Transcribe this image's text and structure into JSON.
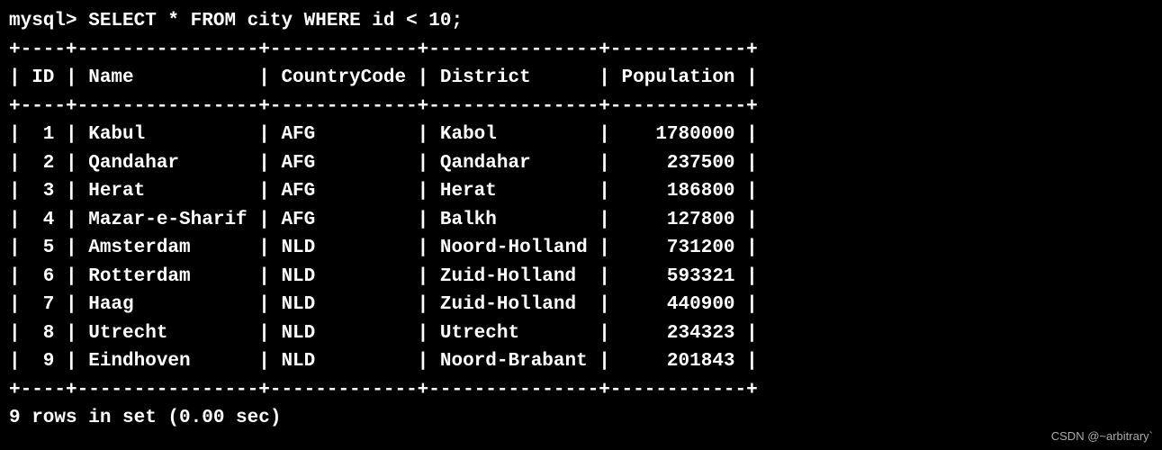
{
  "prompt": "mysql> ",
  "query": "SELECT * FROM city WHERE id < 10;",
  "separator_top": "+----+----------------+-------------+---------------+------------+",
  "header_line": "| ID | Name           | CountryCode | District      | Population |",
  "separator_mid": "+----+----------------+-------------+---------------+------------+",
  "row_lines": [
    "|  1 | Kabul          | AFG         | Kabol         |    1780000 |",
    "|  2 | Qandahar       | AFG         | Qandahar      |     237500 |",
    "|  3 | Herat          | AFG         | Herat         |     186800 |",
    "|  4 | Mazar-e-Sharif | AFG         | Balkh         |     127800 |",
    "|  5 | Amsterdam      | NLD         | Noord-Holland |     731200 |",
    "|  6 | Rotterdam      | NLD         | Zuid-Holland  |     593321 |",
    "|  7 | Haag           | NLD         | Zuid-Holland  |     440900 |",
    "|  8 | Utrecht        | NLD         | Utrecht       |     234323 |",
    "|  9 | Eindhoven      | NLD         | Noord-Brabant |     201843 |"
  ],
  "separator_bottom": "+----+----------------+-------------+---------------+------------+",
  "status": "9 rows in set (0.00 sec)",
  "watermark": "CSDN @~arbitrary`",
  "chart_data": {
    "type": "table",
    "columns": [
      "ID",
      "Name",
      "CountryCode",
      "District",
      "Population"
    ],
    "rows": [
      {
        "ID": 1,
        "Name": "Kabul",
        "CountryCode": "AFG",
        "District": "Kabol",
        "Population": 1780000
      },
      {
        "ID": 2,
        "Name": "Qandahar",
        "CountryCode": "AFG",
        "District": "Qandahar",
        "Population": 237500
      },
      {
        "ID": 3,
        "Name": "Herat",
        "CountryCode": "AFG",
        "District": "Herat",
        "Population": 186800
      },
      {
        "ID": 4,
        "Name": "Mazar-e-Sharif",
        "CountryCode": "AFG",
        "District": "Balkh",
        "Population": 127800
      },
      {
        "ID": 5,
        "Name": "Amsterdam",
        "CountryCode": "NLD",
        "District": "Noord-Holland",
        "Population": 731200
      },
      {
        "ID": 6,
        "Name": "Rotterdam",
        "CountryCode": "NLD",
        "District": "Zuid-Holland",
        "Population": 593321
      },
      {
        "ID": 7,
        "Name": "Haag",
        "CountryCode": "NLD",
        "District": "Zuid-Holland",
        "Population": 440900
      },
      {
        "ID": 8,
        "Name": "Utrecht",
        "CountryCode": "NLD",
        "District": "Utrecht",
        "Population": 234323
      },
      {
        "ID": 9,
        "Name": "Eindhoven",
        "CountryCode": "NLD",
        "District": "Noord-Brabant",
        "Population": 201843
      }
    ]
  }
}
